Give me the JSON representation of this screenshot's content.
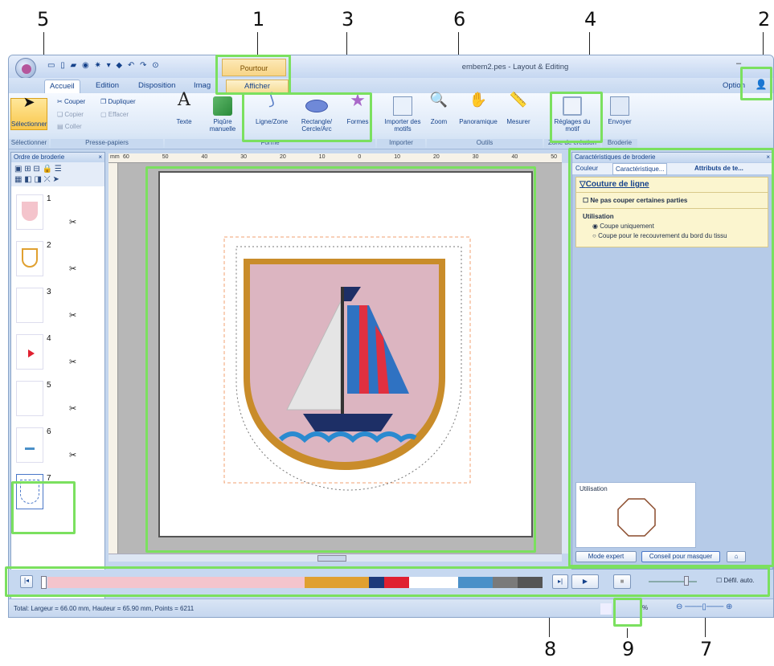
{
  "callouts": [
    "1",
    "2",
    "3",
    "4",
    "5",
    "6",
    "7",
    "8",
    "9"
  ],
  "titlebar": {
    "title": "embem2.pes - Layout & Editing",
    "context_tabs": [
      "Pourtour",
      "Afficher"
    ],
    "option_label": "Option"
  },
  "tabs": [
    "Accueil",
    "Edition",
    "Disposition",
    "Imag"
  ],
  "ribbon": {
    "select_label": "Sélectionner",
    "clip_cut": "Couper",
    "clip_dup": "Dupliquer",
    "clip_copy": "Copier",
    "clip_del": "Effacer",
    "clip_paste": "Coller",
    "text_label": "Texte",
    "manual_label": "Piqûre manuelle",
    "line_label": "Ligne/Zone",
    "rect_label": "Rectangle/ Cercle/Arc",
    "shapes_label": "Formes",
    "import_label": "Importer des motifs",
    "zoom_label": "Zoom",
    "pan_label": "Panoramique",
    "measure_label": "Mesurer",
    "settings_label": "Réglages du motif",
    "send_label": "Envoyer",
    "groups": [
      "Sélectionner",
      "Presse-papiers",
      "Forme",
      "Importer",
      "Outils",
      "Zone de création",
      "Broderie"
    ]
  },
  "left_panel": {
    "title": "Ordre de broderie",
    "items": [
      "1",
      "2",
      "3",
      "4",
      "5",
      "6",
      "7"
    ],
    "scissors": "✂"
  },
  "ruler": {
    "unit": "mm",
    "ticks": [
      "60",
      "50",
      "40",
      "30",
      "20",
      "10",
      "0",
      "10",
      "20",
      "30",
      "40",
      "50"
    ]
  },
  "right_panel": {
    "title": "Caractéristiques de broderie",
    "tabs": [
      "Couleur",
      "Caractéristique...",
      "Attributs de te..."
    ],
    "section": "Couture de ligne",
    "checkbox": "Ne pas couper certaines parties",
    "usage_title": "Utilisation",
    "radio1": "Coupe uniquement",
    "radio2": "Coupe pour le recouvrement du bord du tissu",
    "preview_label": "Utilisation",
    "expert_btn": "Mode expert",
    "tip_btn": "Conseil pour masquer"
  },
  "timeline": {
    "auto_scroll": "Défil. auto.",
    "colors": [
      "#f4c4cc",
      "#e0a030",
      "#1d3a7a",
      "#e02030",
      "#ffffff",
      "#4a90c8",
      "#7a7a7a",
      "#555555"
    ],
    "weights": [
      0.52,
      0.13,
      0.03,
      0.05,
      0.1,
      0.07,
      0.05,
      0.05
    ]
  },
  "status": {
    "text": "Total: Largeur = 66.00 mm, Hauteur = 65.90 mm, Points = 6211",
    "zoom_pct": "%"
  },
  "colors": {
    "highlight": "#7be05f",
    "ribbon_text": "#15428b"
  }
}
